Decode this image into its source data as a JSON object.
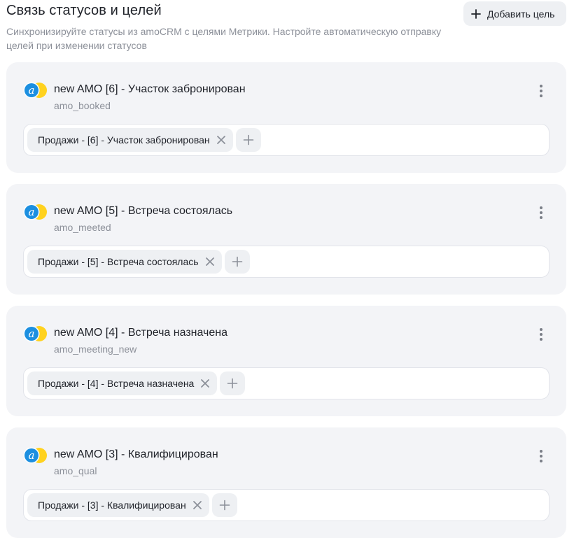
{
  "header": {
    "title": "Связь статусов и целей",
    "description": "Синхронизируйте статусы из amoCRM с целями Метрики. Настройте автоматическую отправку целей при изменении статусов",
    "add_button_label": "Добавить цель"
  },
  "colors": {
    "card_background": "#f3f4f7",
    "chip_background": "#eef0f3",
    "muted_text": "#8c9099",
    "logo_blue": "#1c8fe0",
    "logo_yellow": "#ffd21f"
  },
  "goals": [
    {
      "title": "new AMO [6] - Участок забронирован",
      "code": "amo_booked",
      "chips": [
        {
          "label": "Продажи - [6] - Участок забронирован"
        }
      ]
    },
    {
      "title": "new AMO [5] - Встреча состоялась",
      "code": "amo_meeted",
      "chips": [
        {
          "label": "Продажи - [5] - Встреча состоялась"
        }
      ]
    },
    {
      "title": "new AMO [4] - Встреча назначена",
      "code": "amo_meeting_new",
      "chips": [
        {
          "label": "Продажи - [4] - Встреча назначена"
        }
      ]
    },
    {
      "title": "new AMO [3] - Квалифицирован",
      "code": "amo_qual",
      "chips": [
        {
          "label": "Продажи - [3] - Квалифицирован"
        }
      ]
    }
  ]
}
